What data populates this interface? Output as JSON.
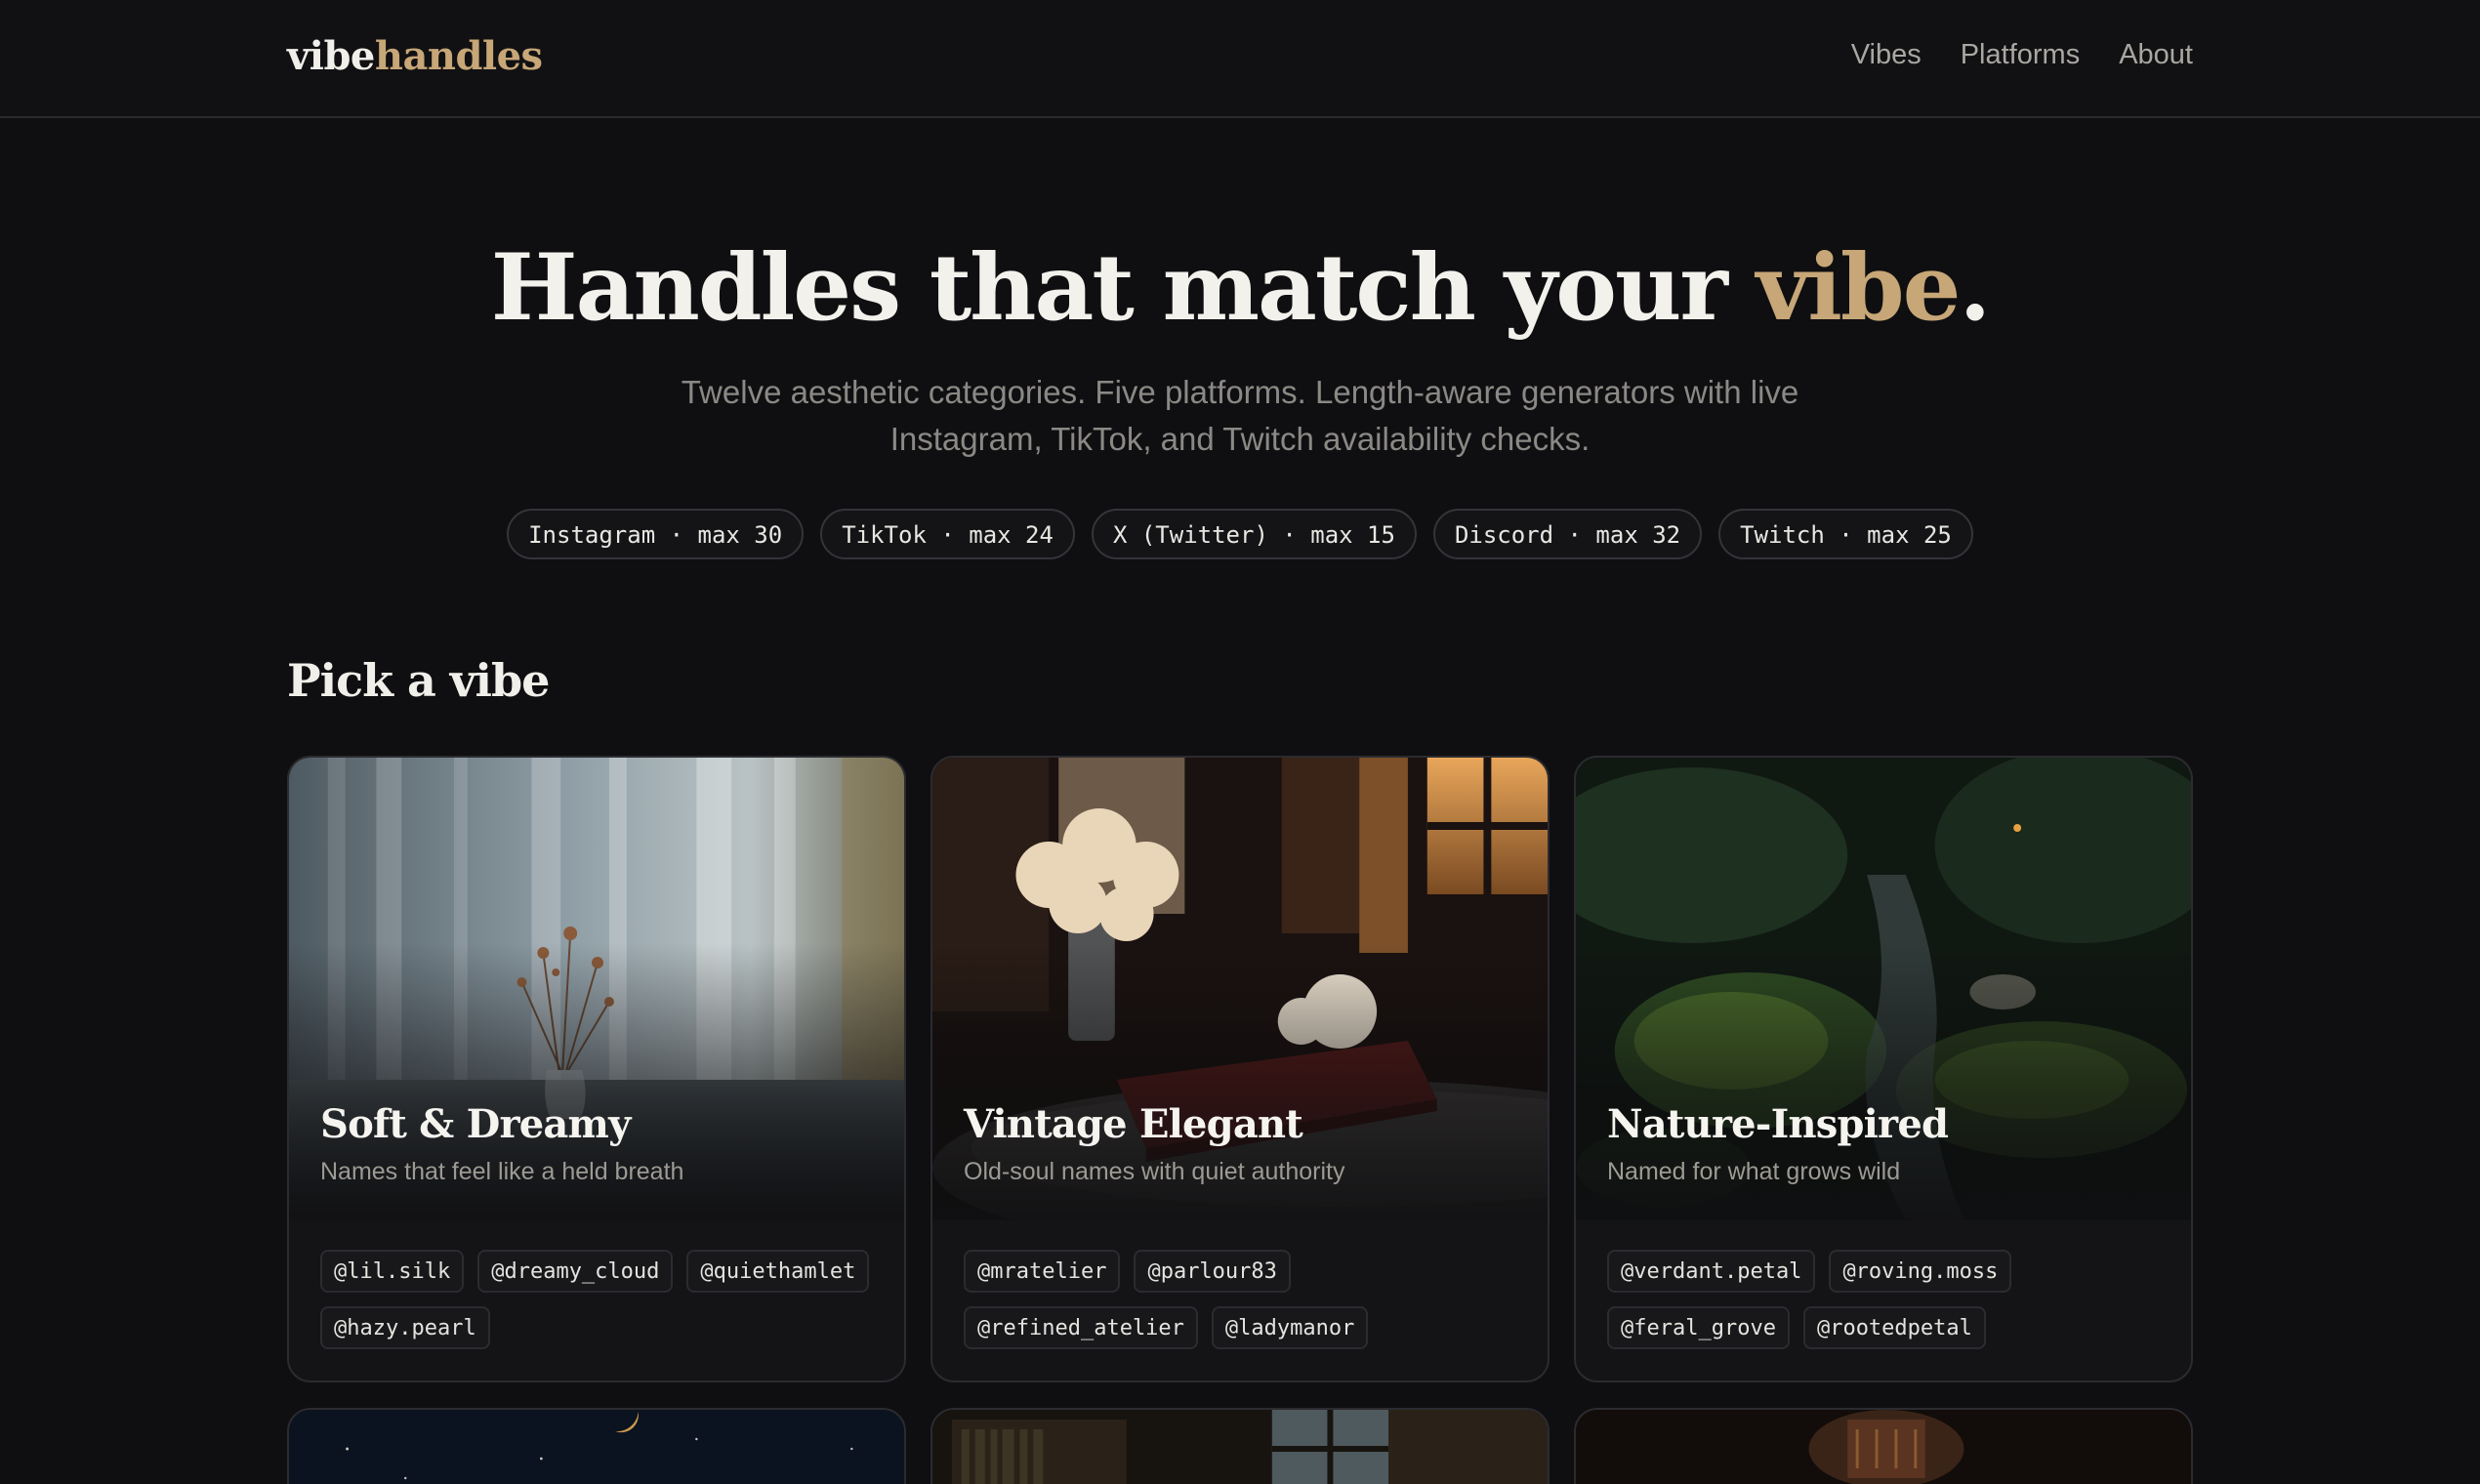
{
  "header": {
    "logo_part1": "vibe",
    "logo_part2": "handles",
    "nav": [
      "Vibes",
      "Platforms",
      "About"
    ]
  },
  "hero": {
    "title_main": "Handles that match your ",
    "title_accent": "vibe",
    "title_end": ".",
    "subtitle": "Twelve aesthetic categories. Five platforms. Length-aware generators with live Instagram, TikTok, and Twitch availability checks.",
    "platforms": [
      "Instagram · max 30",
      "TikTok · max 24",
      "X (Twitter) · max 15",
      "Discord · max 32",
      "Twitch · max 25"
    ]
  },
  "section_title": "Pick a vibe",
  "cards": [
    {
      "title": "Soft & Dreamy",
      "description": "Names that feel like a held breath",
      "handles": [
        "@lil.silk",
        "@dreamy_cloud",
        "@quiethamlet",
        "@hazy.pearl"
      ]
    },
    {
      "title": "Vintage Elegant",
      "description": "Old-soul names with quiet authority",
      "handles": [
        "@mratelier",
        "@parlour83",
        "@refined_atelier",
        "@ladymanor"
      ]
    },
    {
      "title": "Nature-Inspired",
      "description": "Named for what grows wild",
      "handles": [
        "@verdant.petal",
        "@roving.moss",
        "@feral_grove",
        "@rootedpetal"
      ]
    }
  ],
  "colors": {
    "background": "#0f0f11",
    "accent": "#c7a677",
    "text": "#ecebe7",
    "muted": "#8b8985"
  }
}
